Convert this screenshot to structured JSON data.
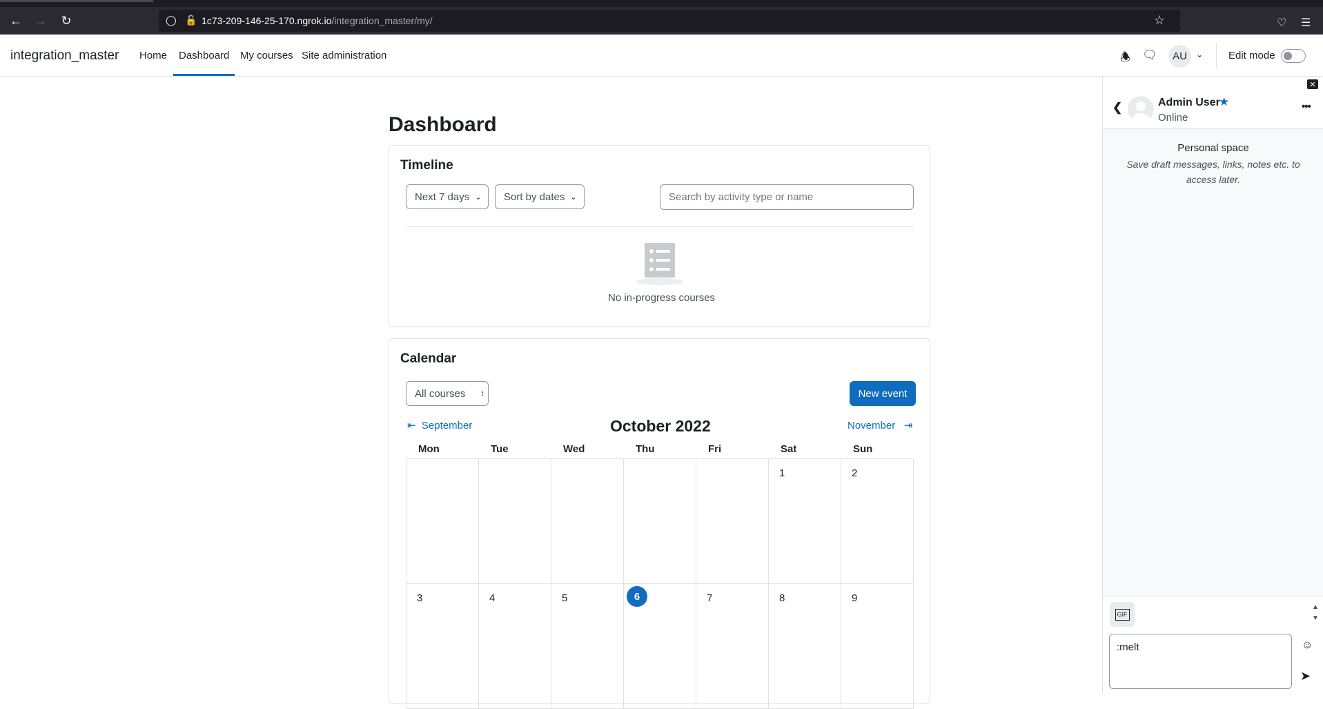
{
  "browser": {
    "url_host": "1c73-209-146-25-170.ngrok.io",
    "url_path": "/integration_master/my/"
  },
  "navbar": {
    "brand": "integration_master",
    "links": [
      "Home",
      "Dashboard",
      "My courses",
      "Site administration"
    ],
    "active_link": "Dashboard",
    "avatar_initials": "AU",
    "edit_mode_label": "Edit mode",
    "edit_mode_on": false
  },
  "main": {
    "page_title": "Dashboard",
    "timeline": {
      "title": "Timeline",
      "range_select": "Next 7 days",
      "sort_select": "Sort by dates",
      "search_placeholder": "Search by activity type or name",
      "empty_text": "No in-progress courses"
    },
    "calendar": {
      "title": "Calendar",
      "course_select": "All courses",
      "new_event_label": "New event",
      "prev_month": "September",
      "next_month": "November",
      "month_title": "October 2022",
      "weekdays": [
        "Mon",
        "Tue",
        "Wed",
        "Thu",
        "Fri",
        "Sat",
        "Sun"
      ],
      "week1": [
        "",
        "",
        "",
        "",
        "",
        "1",
        "2"
      ],
      "week2": [
        "3",
        "4",
        "5",
        "6",
        "7",
        "8",
        "9"
      ],
      "today": "6"
    }
  },
  "drawer": {
    "close_label": "✕",
    "user_name": "Admin User",
    "user_status": "Online",
    "personal_space_title": "Personal space",
    "personal_space_desc": "Save draft messages, links, notes etc. to access later.",
    "emoji_btn_text": "GIF",
    "message_value": ":melt"
  }
}
